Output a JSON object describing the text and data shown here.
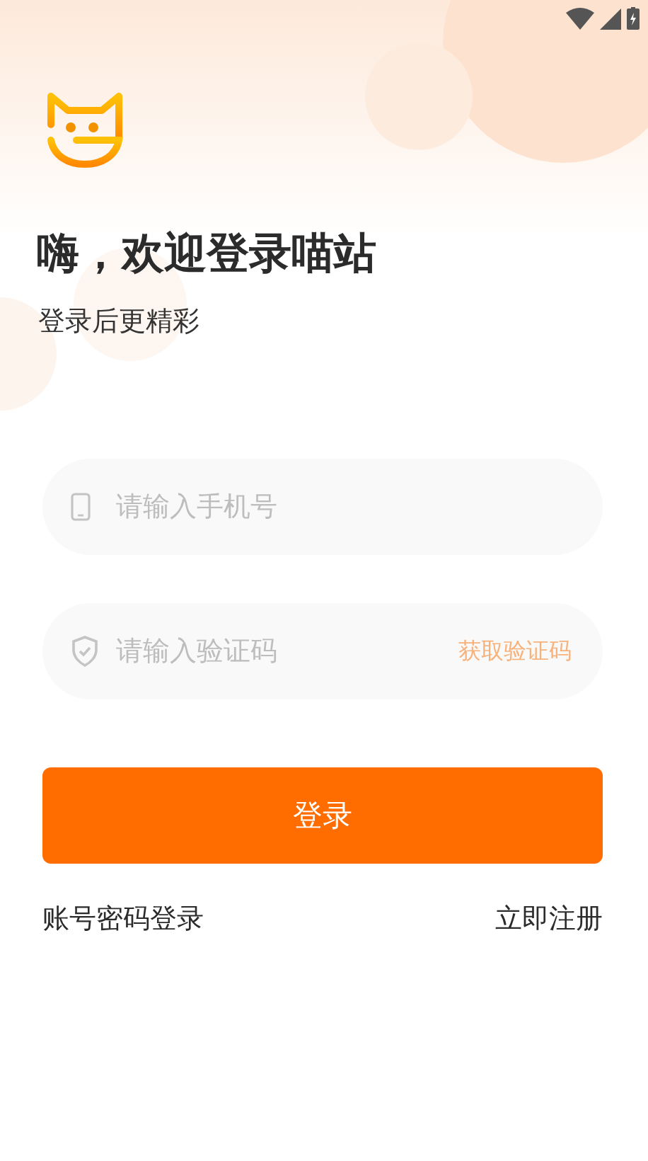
{
  "title": "嗨，欢迎登录喵站",
  "subtitle": "登录后更精彩",
  "fields": [
    {
      "kind": "phone",
      "placeholder": "请输入手机号"
    },
    {
      "kind": "code",
      "placeholder": "请输入验证码",
      "action": "获取验证码"
    }
  ],
  "login_button": "登录",
  "links": [
    "账号密码登录",
    "立即注册"
  ]
}
